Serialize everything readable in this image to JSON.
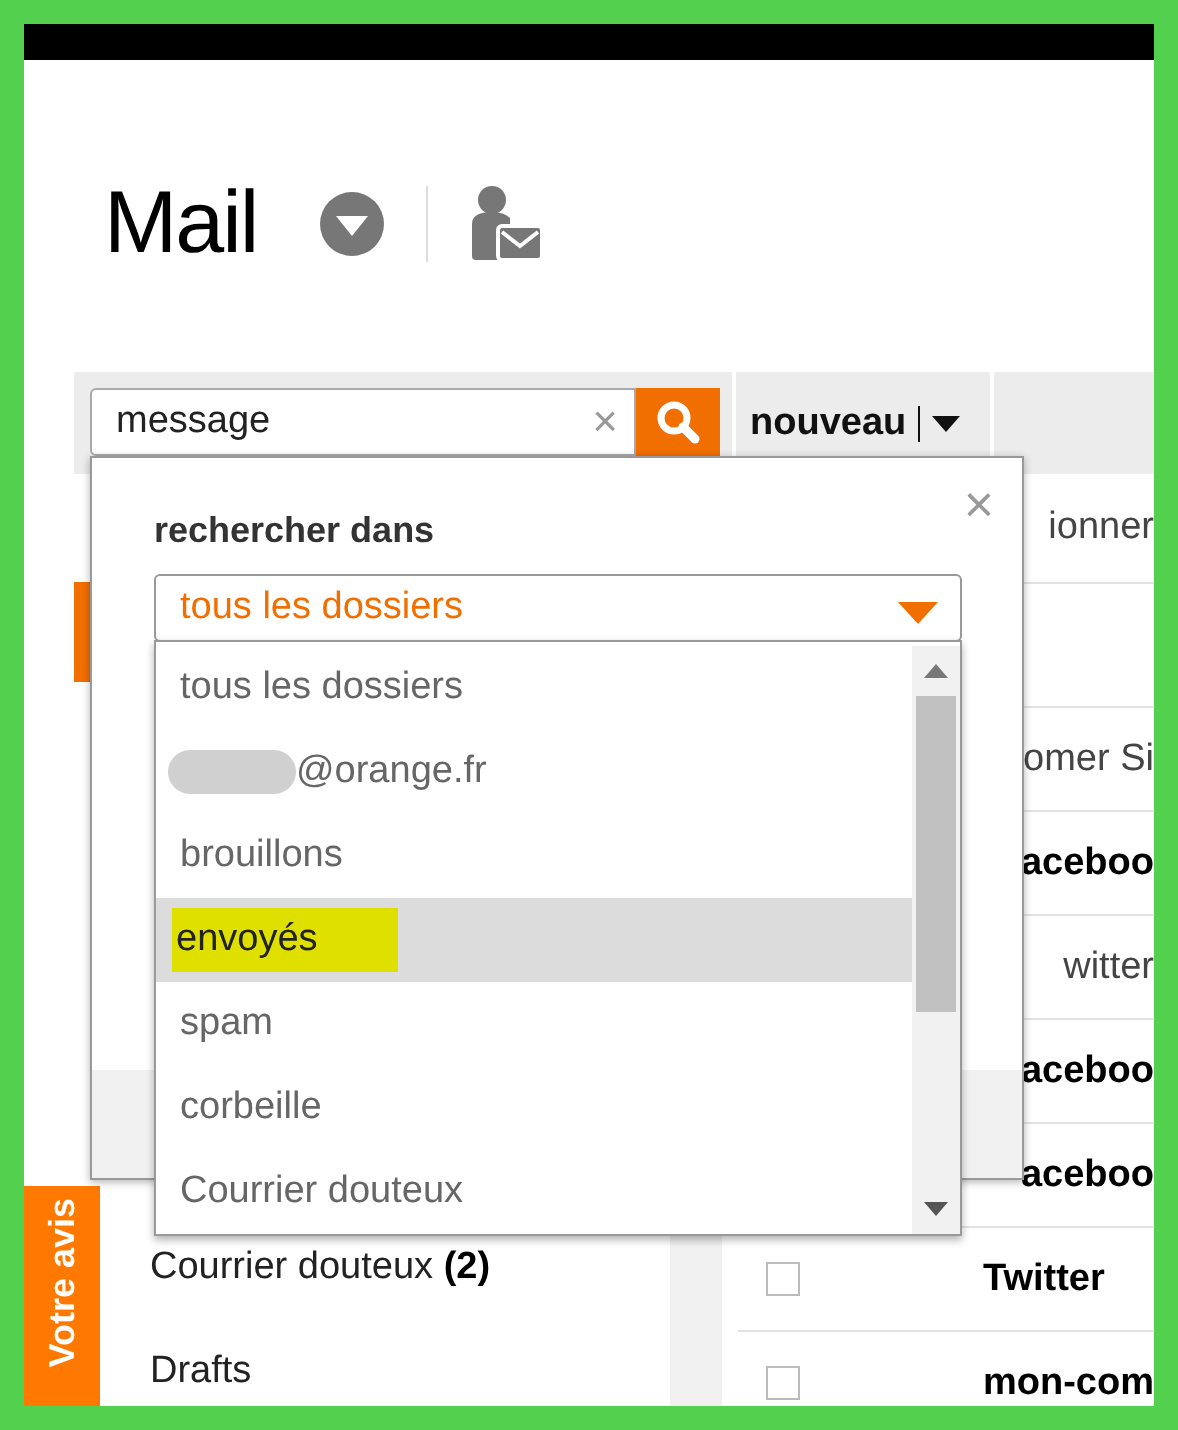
{
  "header": {
    "title": "Mail"
  },
  "search": {
    "value": "message",
    "clear": "×"
  },
  "toolbar": {
    "new_button": "nouveau"
  },
  "sidebar": {
    "items": [
      {
        "label": "Courrier douteux",
        "count": "(2)"
      },
      {
        "label": "Drafts"
      }
    ],
    "feedback_tab": "Votre avis"
  },
  "message_list": {
    "select_all": "ionner",
    "rows": [
      {
        "kind": "cut",
        "sender": "omer Si",
        "bold": false
      },
      {
        "kind": "cut",
        "sender": "aceboo",
        "bold": true
      },
      {
        "kind": "cut",
        "sender": "witter",
        "bold": false
      },
      {
        "kind": "cut",
        "sender": "aceboo",
        "bold": true
      },
      {
        "kind": "cut",
        "sender": "aceboo",
        "bold": true
      },
      {
        "kind": "full",
        "sender": "Twitter",
        "bold": true,
        "checked": false
      },
      {
        "kind": "full",
        "sender": "mon-com",
        "bold": true,
        "checked": false
      }
    ]
  },
  "search_popup": {
    "label": "rechercher dans",
    "close": "×",
    "select": {
      "value": "tous les dossiers",
      "expanded": true
    },
    "options": [
      {
        "label": "tous les dossiers",
        "redacted": false,
        "selected": false,
        "highlighted": false
      },
      {
        "label": "@orange.fr",
        "redacted": true,
        "selected": false,
        "highlighted": false
      },
      {
        "label": "brouillons",
        "redacted": false,
        "selected": false,
        "highlighted": false
      },
      {
        "label": "envoyés",
        "redacted": false,
        "selected": true,
        "highlighted": true
      },
      {
        "label": "spam",
        "redacted": false,
        "selected": false,
        "highlighted": false
      },
      {
        "label": "corbeille",
        "redacted": false,
        "selected": false,
        "highlighted": false
      },
      {
        "label": "Courrier douteux",
        "redacted": false,
        "selected": false,
        "highlighted": false
      }
    ]
  }
}
